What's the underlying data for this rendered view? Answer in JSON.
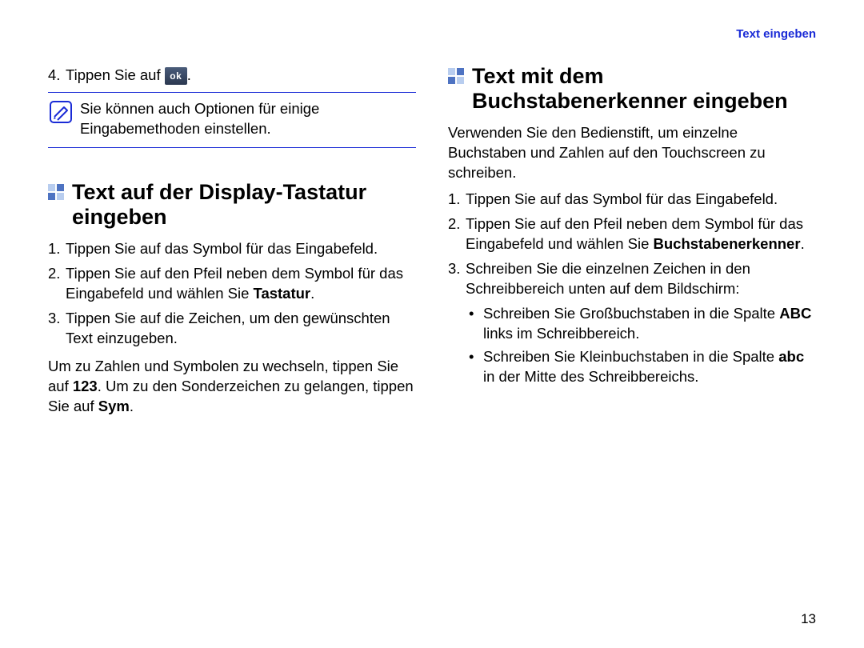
{
  "runningHead": "Text eingeben",
  "pageNumber": "13",
  "left": {
    "step4": {
      "num": "4.",
      "pre": "Tippen Sie auf ",
      "ok": "ok",
      "post": "."
    },
    "note": "Sie können auch Optionen für einige Eingabemethoden einstellen.",
    "section1": {
      "title": "Text auf der Display-Tastatur eingeben",
      "steps": {
        "s1": {
          "n": "1.",
          "t": "Tippen Sie auf das Symbol für das Eingabefeld."
        },
        "s2": {
          "n": "2.",
          "pre": "Tippen Sie auf den Pfeil neben dem Symbol für das Eingabefeld und wählen Sie ",
          "bold": "Tastatur",
          "post": "."
        },
        "s3": {
          "n": "3.",
          "t": "Tippen Sie auf die Zeichen, um den gewünschten Text einzugeben."
        }
      },
      "tail": {
        "p1": "Um zu Zahlen und Symbolen zu wechseln, tippen Sie auf ",
        "b1": "123",
        "p2": ". Um zu den Sonderzeichen zu gelangen, tippen Sie auf ",
        "b2": "Sym",
        "p3": "."
      }
    }
  },
  "right": {
    "section2": {
      "title": "Text mit dem Buchstabenerkenner eingeben",
      "intro": "Verwenden Sie den Bedienstift, um einzelne Buchstaben und Zahlen auf den Touchscreen zu schreiben.",
      "steps": {
        "s1": {
          "n": "1.",
          "t": "Tippen Sie auf das Symbol für das Eingabefeld."
        },
        "s2": {
          "n": "2.",
          "pre": "Tippen Sie auf den Pfeil neben dem Symbol für das Eingabefeld und wählen Sie ",
          "bold": "Buchstabenerkenner",
          "post": "."
        },
        "s3": {
          "n": "3.",
          "t": "Schreiben Sie die einzelnen Zeichen in den Schreibbereich unten auf dem Bildschirm:"
        }
      },
      "bullets": {
        "b1": {
          "pre": "Schreiben Sie Großbuchstaben in die Spalte ",
          "bold": "ABC",
          "post": " links im Schreibbereich."
        },
        "b2": {
          "pre": "Schreiben Sie Kleinbuchstaben in die Spalte ",
          "bold": "abc",
          "post": " in der Mitte des Schreibbereichs."
        }
      }
    }
  }
}
